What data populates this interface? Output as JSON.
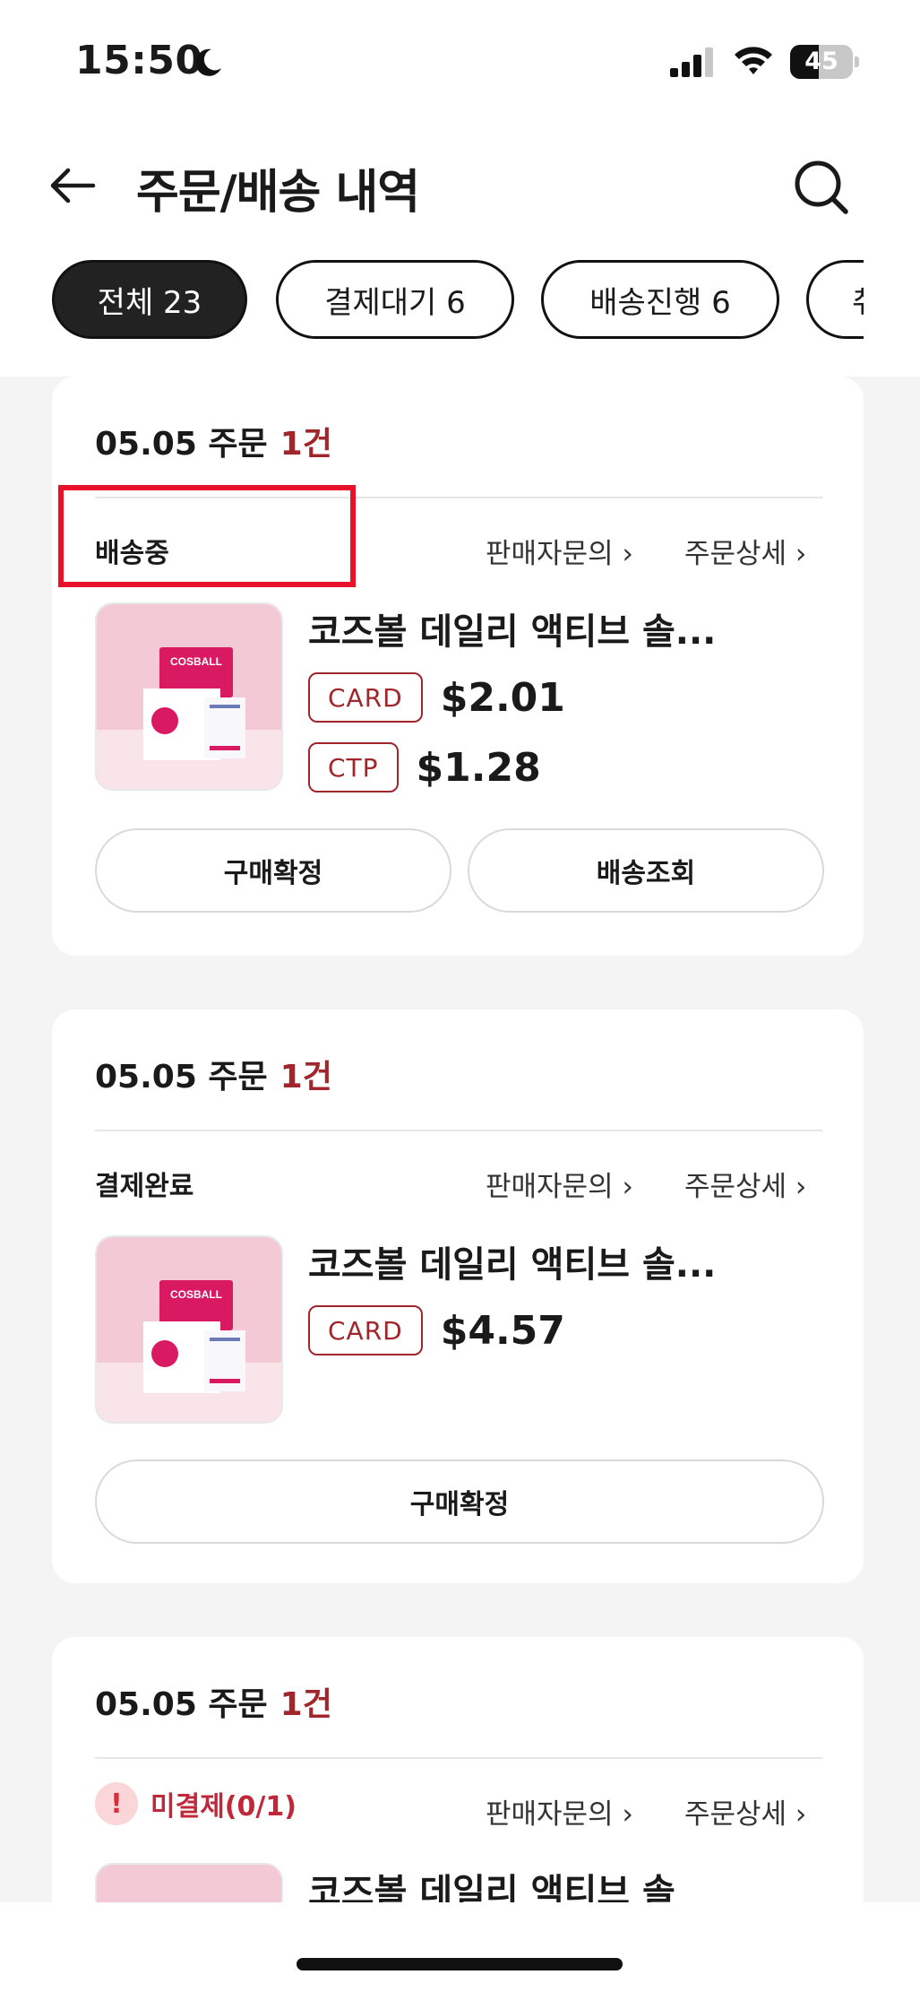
{
  "status_bar": {
    "time": "15:50",
    "battery_level": 45,
    "battery_label": "45"
  },
  "header": {
    "title": "주문/배송 내역"
  },
  "tabs": [
    {
      "label": "전체 23",
      "active": true
    },
    {
      "label": "결제대기 6",
      "active": false
    },
    {
      "label": "배송진행 6",
      "active": false
    },
    {
      "label": "취",
      "active": false
    }
  ],
  "orders": [
    {
      "date": "05.05 주문",
      "count": "1건",
      "status": "배송중",
      "link_seller": "판매자문의 ›",
      "link_detail": "주문상세 ›",
      "product": {
        "name": "코즈볼 데일리 액티브 솔...",
        "brand": "COSBALL",
        "prices": [
          {
            "tag": "CARD",
            "amount": "$2.01"
          },
          {
            "tag": "CTP",
            "amount": "$1.28"
          }
        ]
      },
      "buttons": [
        "구매확정",
        "배송조회"
      ]
    },
    {
      "date": "05.05 주문",
      "count": "1건",
      "status": "결제완료",
      "link_seller": "판매자문의 ›",
      "link_detail": "주문상세 ›",
      "product": {
        "name": "코즈볼 데일리 액티브 솔...",
        "brand": "COSBALL",
        "prices": [
          {
            "tag": "CARD",
            "amount": "$4.57"
          }
        ]
      },
      "buttons": [
        "구매확정"
      ]
    },
    {
      "date": "05.05 주문",
      "count": "1건",
      "status": "미결제(0/1)",
      "status_icon": "!",
      "link_seller": "판매자문의 ›",
      "link_detail": "주문상세 ›",
      "product": {
        "name": "코즈볼 데일리 액티브 솔"
      }
    }
  ],
  "colors": {
    "accent_red": "#a0262c",
    "highlight_red": "#e8102a",
    "product_pink": "#d91a63",
    "background_gray": "#f4f4f4"
  }
}
